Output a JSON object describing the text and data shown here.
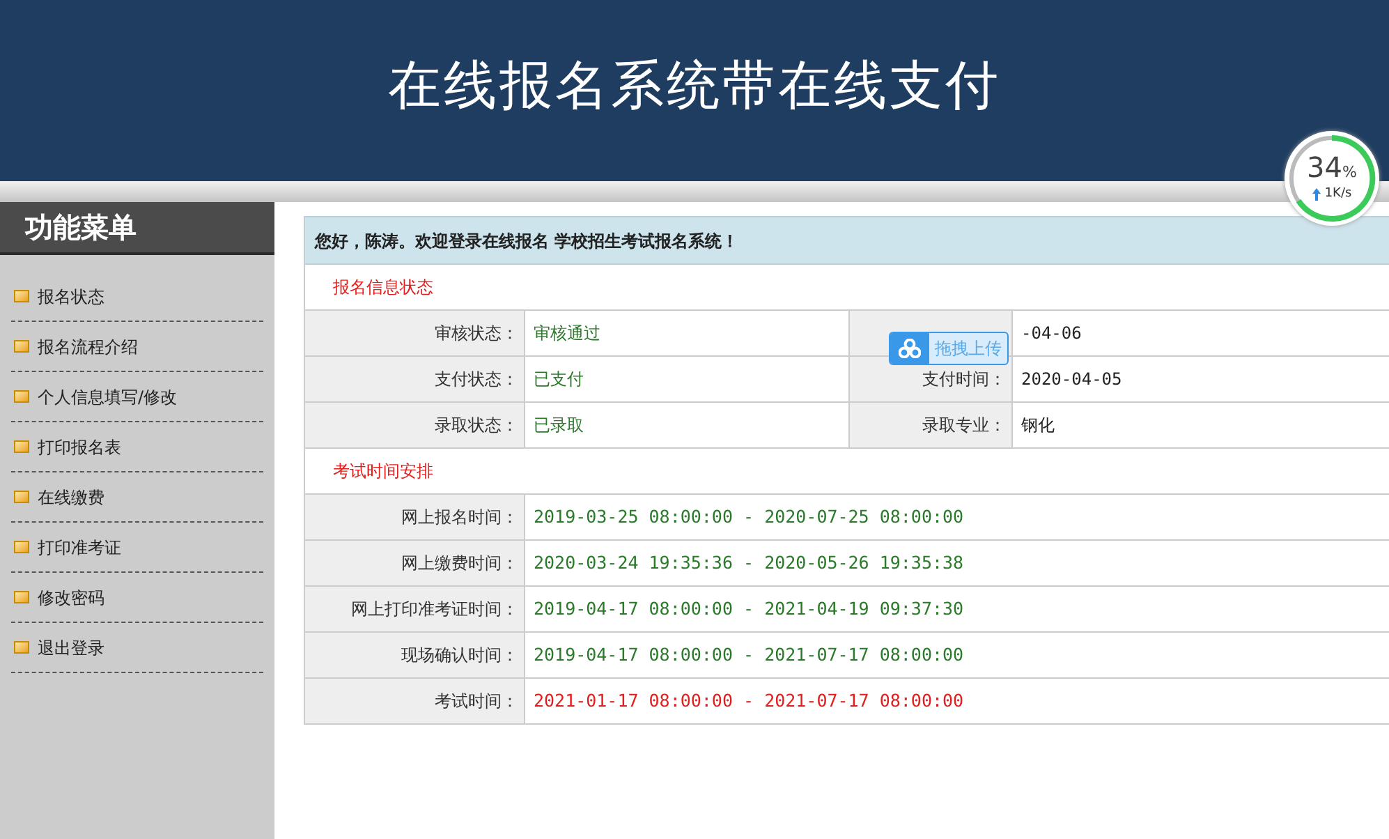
{
  "header": {
    "title": "在线报名系统带在线支付"
  },
  "sidebar": {
    "title": "功能菜单",
    "items": [
      {
        "label": "报名状态"
      },
      {
        "label": "报名流程介绍"
      },
      {
        "label": "个人信息填写/修改"
      },
      {
        "label": "打印报名表"
      },
      {
        "label": "在线缴费"
      },
      {
        "label": "打印准考证"
      },
      {
        "label": "修改密码"
      },
      {
        "label": "退出登录"
      }
    ]
  },
  "welcome": "您好，陈涛。欢迎登录在线报名 学校招生考试报名系统！",
  "status_section": {
    "title": "报名信息状态",
    "rows": [
      {
        "label": "审核状态：",
        "value": "审核通过",
        "label_2": null,
        "value_2": "-04-06"
      },
      {
        "label": "支付状态：",
        "value": "已支付",
        "label_2": "支付时间：",
        "value_2": "2020-04-05"
      },
      {
        "label": "录取状态：",
        "value": "已录取",
        "label_2": "录取专业：",
        "value_2": "钢化"
      }
    ]
  },
  "schedule_section": {
    "title": "考试时间安排",
    "rows": [
      {
        "label": "网上报名时间：",
        "value": "2019-03-25 08:00:00 - 2020-07-25 08:00:00",
        "color": "#2a7a2a"
      },
      {
        "label": "网上缴费时间：",
        "value": "2020-03-24 19:35:36 - 2020-05-26 19:35:38",
        "color": "#2a7a2a"
      },
      {
        "label": "网上打印准考证时间：",
        "value": "2019-04-17 08:00:00 - 2021-04-19 09:37:30",
        "color": "#2a7a2a"
      },
      {
        "label": "现场确认时间：",
        "value": "2019-04-17 08:00:00 - 2021-07-17 08:00:00",
        "color": "#2a7a2a"
      },
      {
        "label": "考试时间：",
        "value": "2021-01-17 08:00:00 - 2021-07-17 08:00:00",
        "color": "#e0201e"
      }
    ]
  },
  "upload_button": {
    "label": "拖拽上传"
  },
  "speed_widget": {
    "percent": "34",
    "unit": "%",
    "rate": "1K/s"
  }
}
